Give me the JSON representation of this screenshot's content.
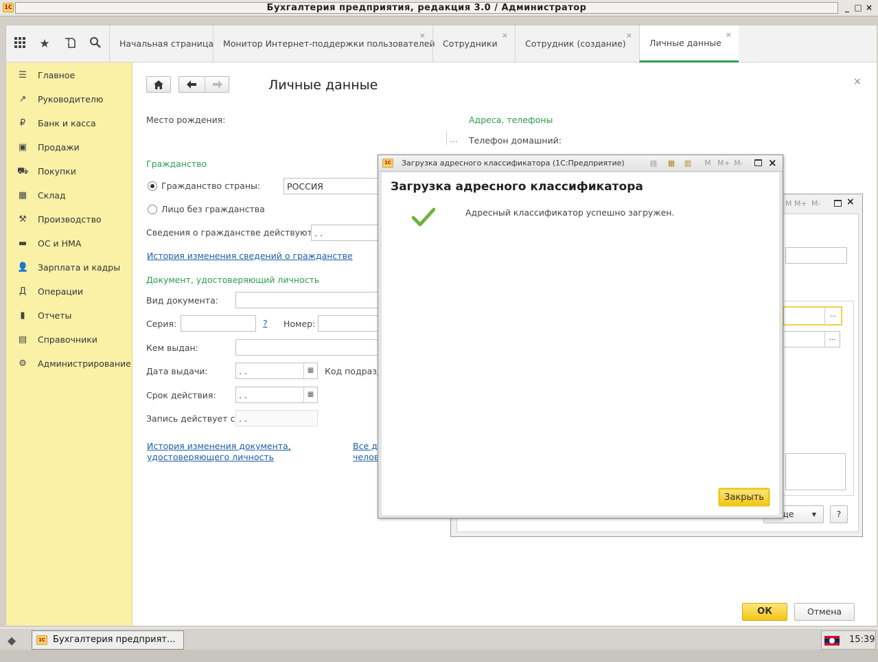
{
  "window": {
    "title": "Бухгалтерия предприятия, редакция 3.0 / Администратор",
    "logo": "1С",
    "buttons": [
      "_",
      "□",
      "×"
    ]
  },
  "tabs": {
    "icons": [
      "apps-grid-icon",
      "star-icon",
      "history-icon",
      "search-icon"
    ],
    "items": [
      {
        "label": "Начальная страница"
      },
      {
        "label": "Монитор Интернет-поддержки пользователей",
        "close": "×"
      },
      {
        "label": "Сотрудники",
        "close": "×"
      },
      {
        "label": "Сотрудник (создание)",
        "close": "×"
      },
      {
        "label": "Личные данные",
        "close": "×"
      }
    ]
  },
  "sidebar": {
    "items": [
      {
        "label": "Главное",
        "icon": "☰"
      },
      {
        "label": "Руководителю",
        "icon": "↗"
      },
      {
        "label": "Банк и касса",
        "icon": "₽"
      },
      {
        "label": "Продажи",
        "icon": "▣"
      },
      {
        "label": "Покупки",
        "icon": "⛟"
      },
      {
        "label": "Склад",
        "icon": "▦"
      },
      {
        "label": "Производство",
        "icon": "⚒"
      },
      {
        "label": "ОС и НМА",
        "icon": "▬"
      },
      {
        "label": "Зарплата и кадры",
        "icon": "👤"
      },
      {
        "label": "Операции",
        "icon": "Д"
      },
      {
        "label": "Отчеты",
        "icon": "▮"
      },
      {
        "label": "Справочники",
        "icon": "▤"
      },
      {
        "label": "Администрирование",
        "icon": "⚙"
      }
    ]
  },
  "form": {
    "title": "Личные данные",
    "close": "×",
    "birthplace_label": "Место рождения:",
    "addresses_header": "Адреса, телефоны",
    "home_phone_label": "Телефон домашний:",
    "ellipsis": "...",
    "citizenship_header": "Гражданство",
    "citizenship_country_label": "Гражданство страны:",
    "citizenship_country_value": "РОССИЯ",
    "stateless_label": "Лицо без гражданства",
    "citizenship_from_label": "Сведения о гражданстве действуют с:",
    "date_placeholder": " .  .",
    "citizenship_history_link": "История изменения сведений о гражданстве",
    "id_doc_header": "Документ, удостоверяющий личность",
    "doc_type_label": "Вид документа:",
    "series_label": "Серия:",
    "question": "?",
    "number_label": "Номер:",
    "issued_by_label": "Кем выдан:",
    "issue_date_label": "Дата выдачи:",
    "dept_code_label": "Код подразд",
    "valid_until_label": "Срок действия:",
    "record_from_label": "Запись действует с:",
    "doc_history_link_1": "История изменения документа,",
    "doc_history_link_2": "удостоверяющего личность",
    "all_docs_link_1": "Все д",
    "all_docs_link_2": "челов",
    "ok_label": "ОК",
    "cancel_label": "Отмена"
  },
  "background_dialog": {
    "more_label": "ще",
    "dropdown": "▾",
    "help": "?",
    "ellipsis": "..."
  },
  "dialog": {
    "caption": "Загрузка адресного классификатора  (1С:Предприятие)",
    "toolbar": [
      "M",
      "M+",
      "M-"
    ],
    "heading": "Загрузка адресного классификатора",
    "message": "Адресный классификатор успешно загружен.",
    "close_label": "Закрыть"
  },
  "taskbar": {
    "app_label": "Бухгалтерия предприят...",
    "time": "15:39"
  },
  "colors": {
    "accent_green": "#2c9d4c",
    "sidebar_bg": "#faf0a6",
    "primary_button": "#f5c518",
    "link": "#1a5ea8"
  }
}
